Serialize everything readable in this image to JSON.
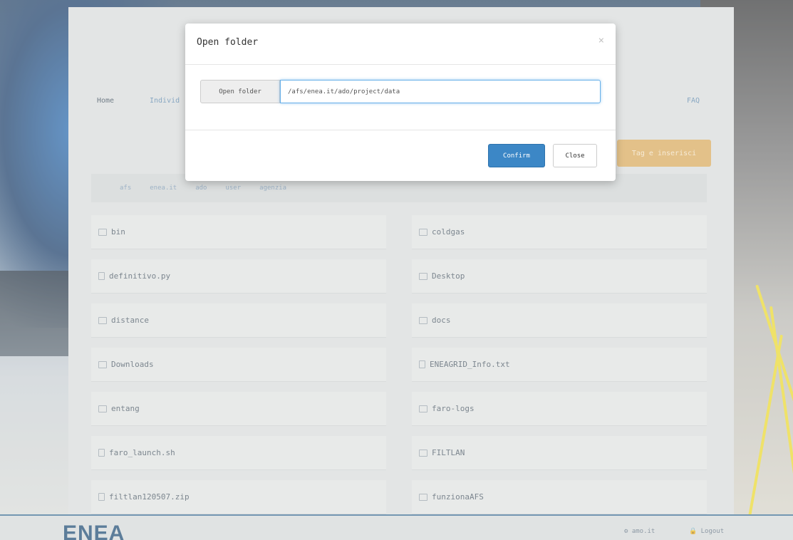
{
  "nav": {
    "home": "Home",
    "cut": "Individ",
    "faq": "FAQ"
  },
  "action_button": "Tag e inserisci",
  "breadcrumb": [
    "afs",
    "enea.it",
    "ado",
    "user",
    "agenzia"
  ],
  "files": [
    {
      "name": "bin",
      "type": "folder"
    },
    {
      "name": "coldgas",
      "type": "folder"
    },
    {
      "name": "definitivo.py",
      "type": "file"
    },
    {
      "name": "Desktop",
      "type": "folder"
    },
    {
      "name": "distance",
      "type": "folder"
    },
    {
      "name": "docs",
      "type": "folder"
    },
    {
      "name": "Downloads",
      "type": "folder"
    },
    {
      "name": "ENEAGRID_Info.txt",
      "type": "file"
    },
    {
      "name": "entang",
      "type": "folder"
    },
    {
      "name": "faro-logs",
      "type": "folder"
    },
    {
      "name": "faro_launch.sh",
      "type": "file"
    },
    {
      "name": "FILTLAN",
      "type": "folder"
    },
    {
      "name": "filtlan120507.zip",
      "type": "file"
    },
    {
      "name": "funzionaAFS",
      "type": "folder"
    }
  ],
  "footer": {
    "logo": "ENEA",
    "user": "amo.it",
    "logout": "Logout"
  },
  "modal": {
    "title": "Open folder",
    "close_symbol": "×",
    "field_label": "Open folder",
    "field_value": "/afs/enea.it/ado/project/data",
    "confirm": "Confirm",
    "close": "Close"
  },
  "colors": {
    "primary": "#3c87c6",
    "accent": "#d9a95c",
    "brand": "#1e4b73"
  }
}
